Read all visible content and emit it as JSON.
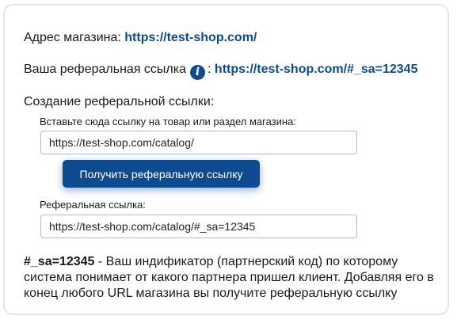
{
  "store_address": {
    "label": "Адрес магазина:",
    "url": "https://test-shop.com/"
  },
  "referral_link": {
    "label": "Ваша реферальная ссылка",
    "separator": ":",
    "info_icon": "info-icon",
    "url": "https://test-shop.com/#_sa=12345"
  },
  "create_section": {
    "title": "Создание реферальной ссылки:",
    "input_label": "Вставьте сюда ссылку на товар или раздел магазина:",
    "input_value": "https://test-shop.com/catalog/",
    "button_label": "Получить реферальную ссылку",
    "result_label": "Реферальная ссылка:",
    "result_value": "https://test-shop.com/catalog/#_sa=12345"
  },
  "note": {
    "code": "#_sa=12345",
    "text": " - Ваш индификатор (партнерский код) по которому система понимает от какого партнера пришел клиент. Добавляя его в конец любого URL магазина вы получите реферальную ссылку"
  },
  "colors": {
    "accent": "#0d4b91",
    "border": "#e6e6e6",
    "field_border": "#a9bdd3"
  }
}
